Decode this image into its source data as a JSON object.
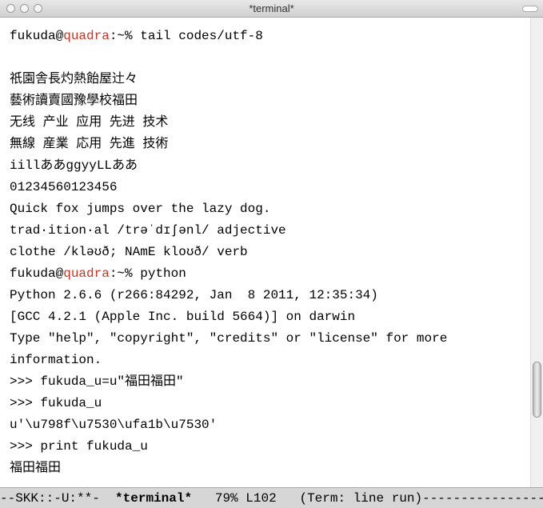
{
  "window": {
    "title": "*terminal*"
  },
  "prompt": {
    "user": "fukuda@",
    "host": "quadra",
    "suffix": ":~% "
  },
  "cmd1": "tail codes/utf-8",
  "lines": {
    "l1": "祇園舎長灼熱飴屋辻々",
    "l2": "藝術讀賣國豫學校福田",
    "l3": "无线 产业 应用 先进 技术",
    "l4": "無線 産業 応用 先進 技術",
    "l5": "iillああggyyLLああ",
    "l6": "01234560123456",
    "l7": "Quick fox jumps over the lazy dog.",
    "l8": "trad·ition·al /trəˈdɪʃənl/ adjective",
    "l9": "clothe /kləʊð; NAmE kloʊð/ verb"
  },
  "cmd2": "python",
  "py": {
    "l1": "Python 2.6.6 (r266:84292, Jan  8 2011, 12:35:34)",
    "l2": "[GCC 4.2.1 (Apple Inc. build 5664)] on darwin",
    "l3": "Type \"help\", \"copyright\", \"credits\" or \"license\" for more",
    "l4": "information.",
    "p1": ">>> fukuda_u=u\"福田福田\"",
    "p2": ">>> fukuda_u",
    "r1": "u'\\u798f\\u7530\\ufa1b\\u7530'",
    "p3": ">>> print fukuda_u",
    "r2": "福田福田"
  },
  "modeline": {
    "left": "--SKK::-U:**-  ",
    "buffer": "*terminal*",
    "mid": "   79% L102   (Term: line run)",
    "dashes": "-----------------"
  }
}
